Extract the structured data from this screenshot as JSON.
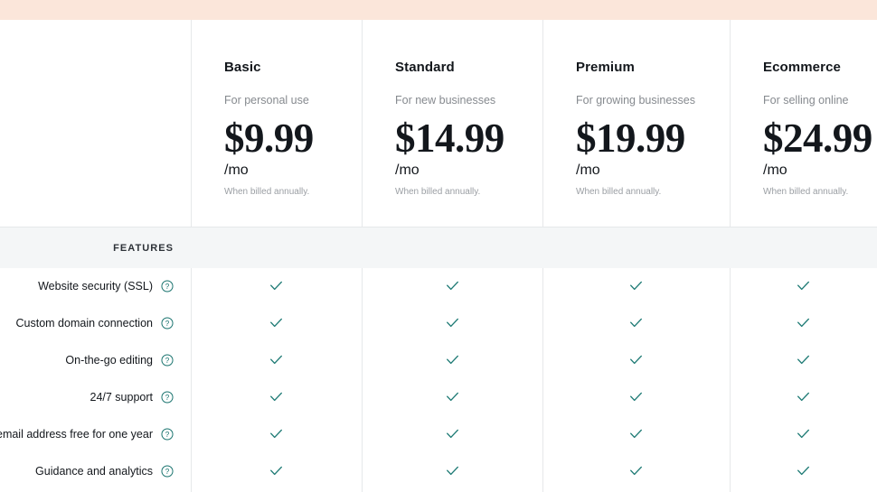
{
  "promo_banner": {
    "color": "#fbe6da"
  },
  "theme": {
    "accent_teal": "#14706b",
    "check_color": "#1d7a74",
    "band_background": "#f4f6f7",
    "rule_color": "#e6e8ea",
    "text_primary": "#13171c",
    "text_muted": "#868a8f"
  },
  "plans": [
    {
      "name": "Basic",
      "tagline": "For personal use",
      "price": "$9.99",
      "period": "/mo",
      "billing_note": "When billed annually."
    },
    {
      "name": "Standard",
      "tagline": "For new businesses",
      "price": "$14.99",
      "period": "/mo",
      "billing_note": "When billed annually."
    },
    {
      "name": "Premium",
      "tagline": "For growing businesses",
      "price": "$19.99",
      "period": "/mo",
      "billing_note": "When billed annually."
    },
    {
      "name": "Ecommerce",
      "tagline": "For selling online",
      "price": "$24.99",
      "period": "/mo",
      "billing_note": "When billed annually."
    }
  ],
  "features_section": {
    "header_label": "FEATURES",
    "help_icon_name": "help-circle-icon",
    "check_icon_name": "checkmark-icon",
    "rows": [
      {
        "label": "Website security (SSL)",
        "values": [
          "check",
          "check",
          "check",
          "check"
        ]
      },
      {
        "label": "Custom domain connection",
        "values": [
          "check",
          "check",
          "check",
          "check"
        ]
      },
      {
        "label": "On-the-go editing",
        "values": [
          "check",
          "check",
          "check",
          "check"
        ]
      },
      {
        "label": "24/7 support",
        "values": [
          "check",
          "check",
          "check",
          "check"
        ]
      },
      {
        "label": "s email address free for one year",
        "values": [
          "check",
          "check",
          "check",
          "check"
        ]
      },
      {
        "label": "Guidance and analytics",
        "values": [
          "check",
          "check",
          "check",
          "check"
        ]
      }
    ]
  }
}
